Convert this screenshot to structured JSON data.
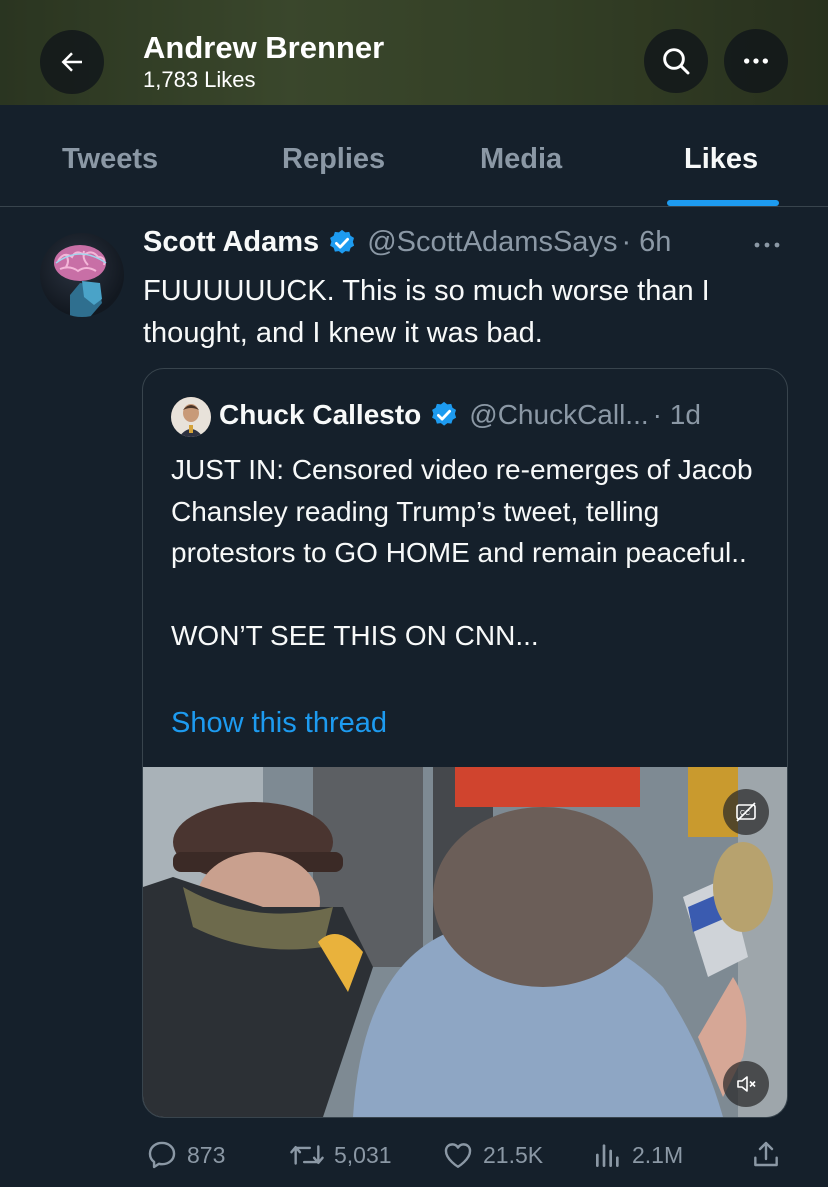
{
  "header": {
    "profile_name": "Andrew Brenner",
    "likes_count": "1,783 Likes",
    "back_icon": "arrow-left-icon",
    "search_icon": "search-icon",
    "more_icon": "more-icon"
  },
  "tabs": [
    {
      "label": "Tweets",
      "active": false
    },
    {
      "label": "Replies",
      "active": false
    },
    {
      "label": "Media",
      "active": false
    },
    {
      "label": "Likes",
      "active": true
    }
  ],
  "tweet": {
    "author_name": "Scott Adams",
    "author_handle": "@ScottAdamsSays",
    "time": "· 6h",
    "text": "FUUUUUUCK. This is so much worse than I thought, and I knew it was bad.",
    "quote": {
      "author_name": "Chuck Callesto",
      "author_handle": "@ChuckCall...",
      "time": "· 1d",
      "text": "JUST IN: Censored video re-emerges of Jacob Chansley reading Trump’s tweet, telling protestors to GO HOME and remain peaceful..\n\nWON’T SEE THIS ON CNN...",
      "show_thread": "Show this thread",
      "media_captions_icon": "captions-off-icon",
      "media_mute_icon": "volume-mute-icon"
    },
    "actions": {
      "replies": "873",
      "retweets": "5,031",
      "likes": "21.5K",
      "views": "2.1M"
    }
  },
  "colors": {
    "background": "#15202b",
    "accent": "#1d9bf0",
    "secondary_text": "#8b98a5",
    "border": "#38444d"
  }
}
